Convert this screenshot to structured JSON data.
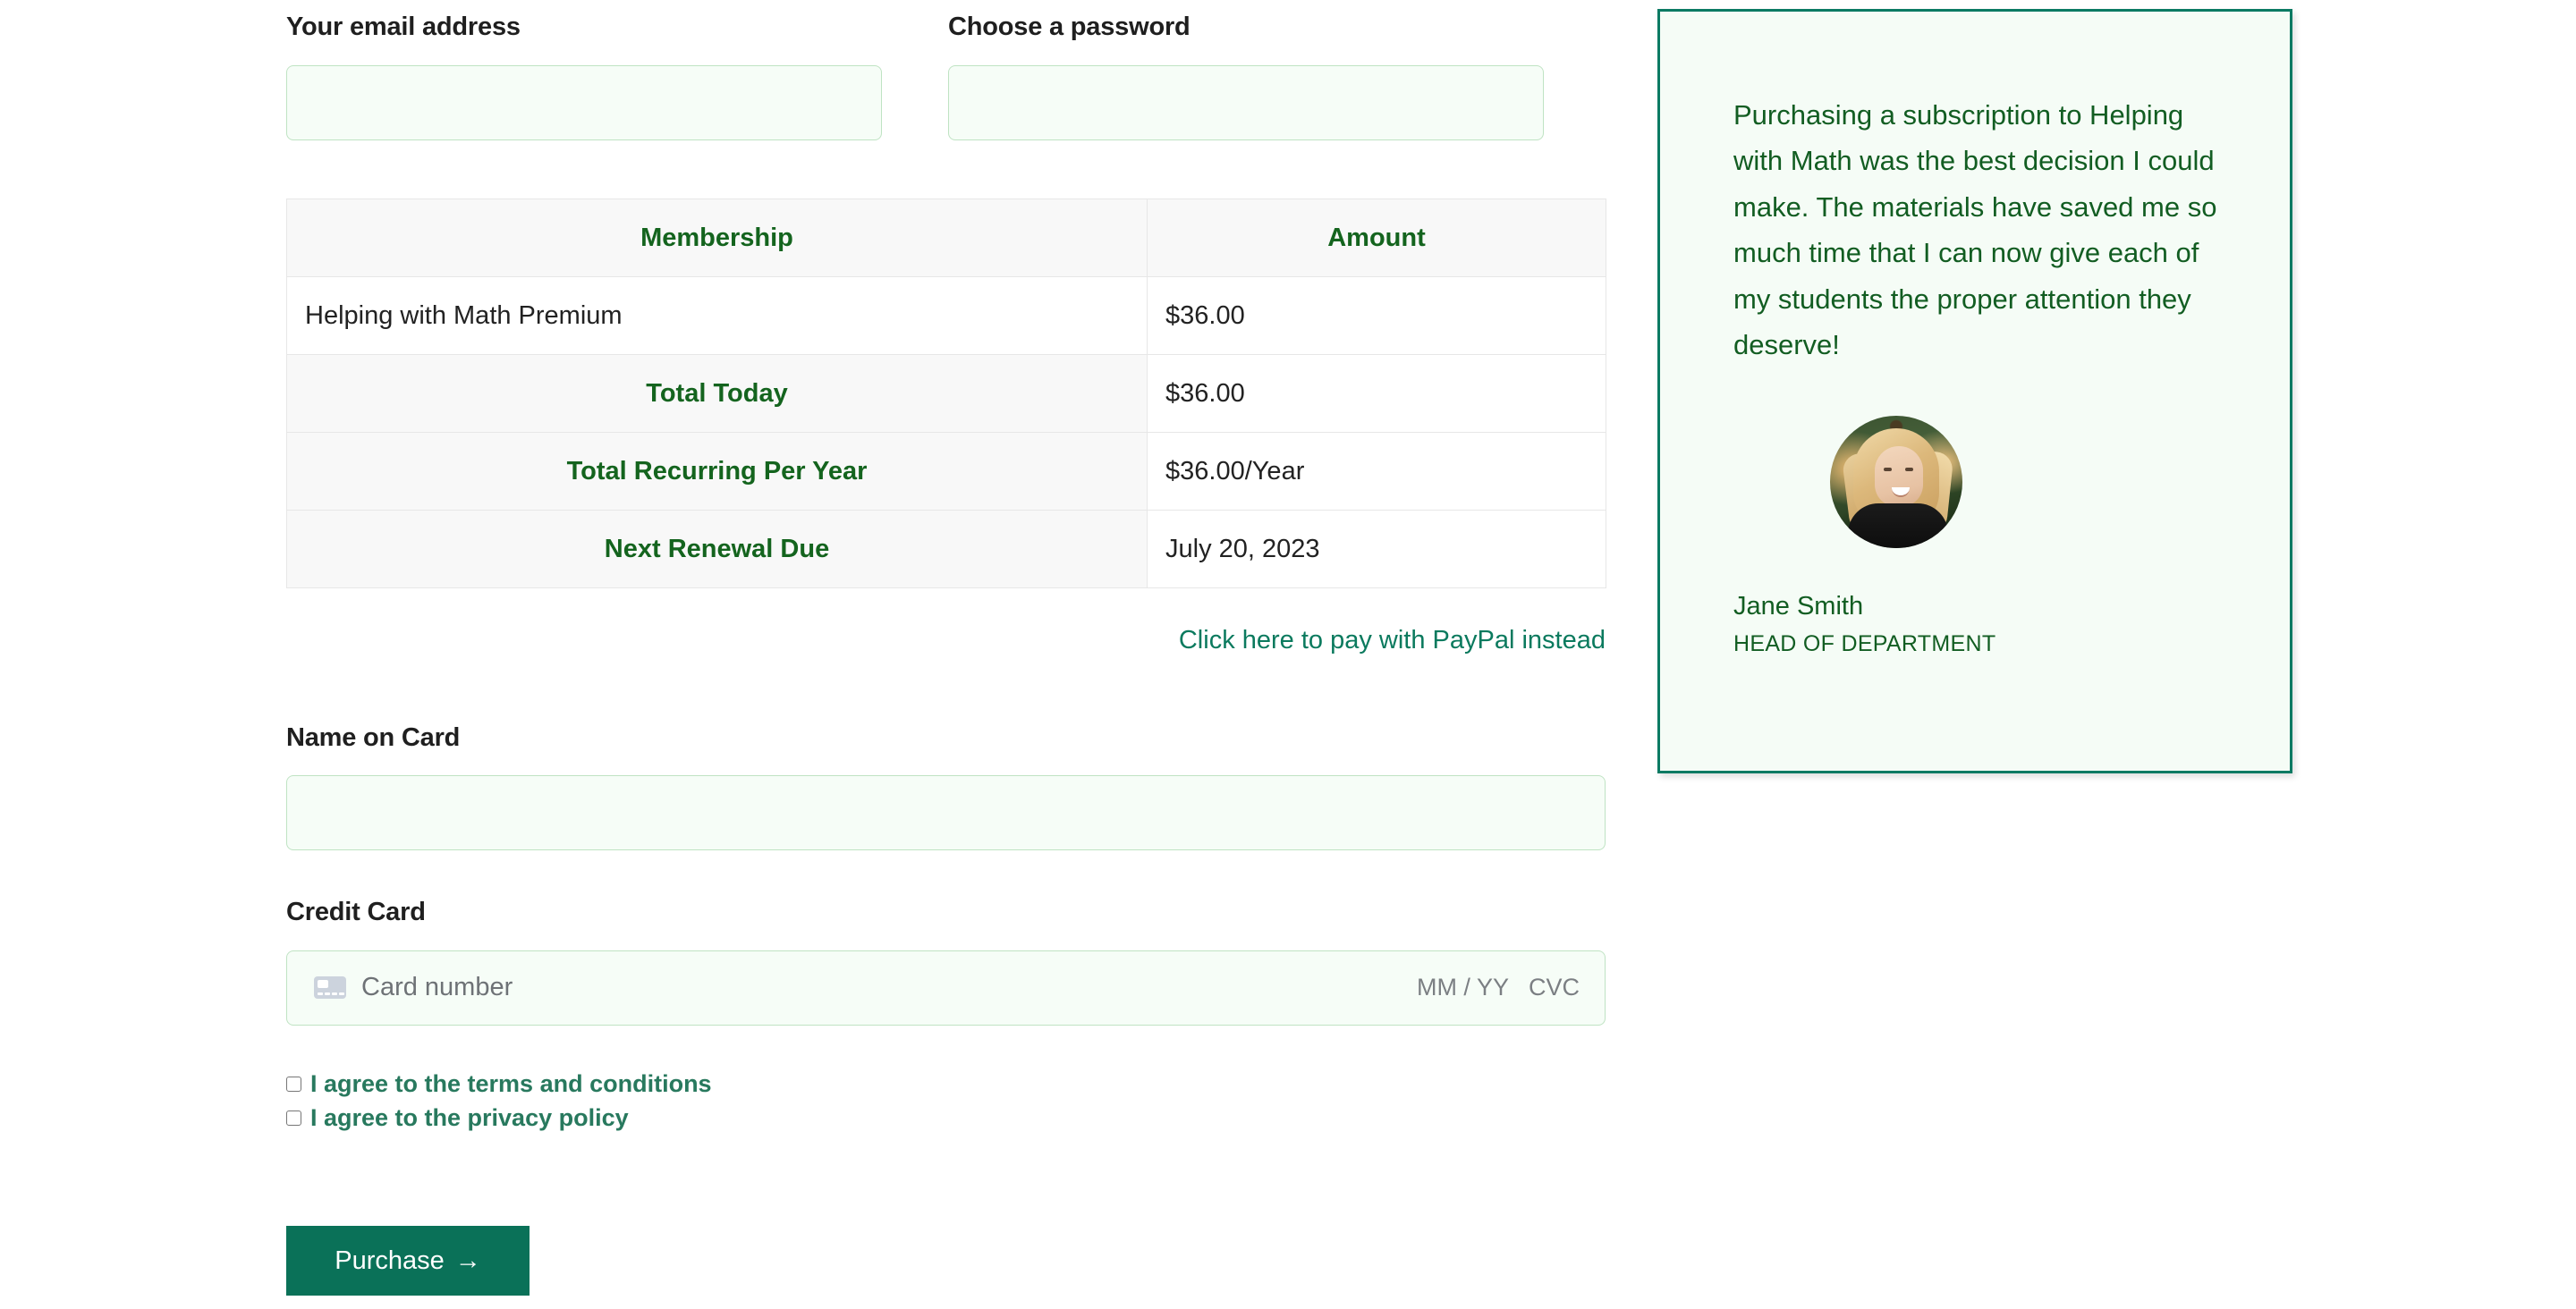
{
  "form": {
    "email": {
      "label": "Your email address",
      "value": "",
      "placeholder": ""
    },
    "password": {
      "label": "Choose a password",
      "value": "",
      "placeholder": ""
    },
    "name_on_card": {
      "label": "Name on Card",
      "value": "",
      "placeholder": ""
    },
    "credit_card": {
      "label": "Credit Card",
      "number_placeholder": "Card number",
      "expiry_placeholder": "MM / YY",
      "cvc_placeholder": "CVC",
      "card_icon": "credit-card-icon"
    }
  },
  "membership_table": {
    "headers": [
      "Membership",
      "Amount"
    ],
    "rows": [
      {
        "label": "Helping with Math Premium",
        "amount": "$36.00",
        "emphasis": false
      },
      {
        "label": "Total Today",
        "amount": "$36.00",
        "emphasis": true
      },
      {
        "label": "Total Recurring Per Year",
        "amount": "$36.00/Year",
        "emphasis": true
      },
      {
        "label": "Next Renewal Due",
        "amount": "July 20, 2023",
        "emphasis": true
      }
    ]
  },
  "paypal": {
    "link_text": "Click here to pay with PayPal instead"
  },
  "agreements": [
    {
      "label": "I agree to the terms and conditions",
      "checked": false
    },
    {
      "label": "I agree to the privacy policy",
      "checked": false
    }
  ],
  "purchase_button": {
    "label": "Purchase",
    "arrow": "→"
  },
  "testimonial": {
    "quote": "Purchasing a subscription to Helping with Math was the best decision I could make. The materials have saved me so much time that I can now give each of my students the proper attention they deserve!",
    "author_name": "Jane Smith",
    "author_role": "HEAD OF DEPARTMENT",
    "avatar_alt": "avatar-photo"
  },
  "colors": {
    "brand_green": "#0a7158",
    "link_teal": "#0b7a5e",
    "table_heading_green": "#14641e",
    "testimonial_text": "#125d22",
    "testimonial_border": "#0b7a63",
    "testimonial_bg": "#f5fcf6",
    "input_bg": "#f6fdf7",
    "input_border": "#bfe3c3"
  }
}
